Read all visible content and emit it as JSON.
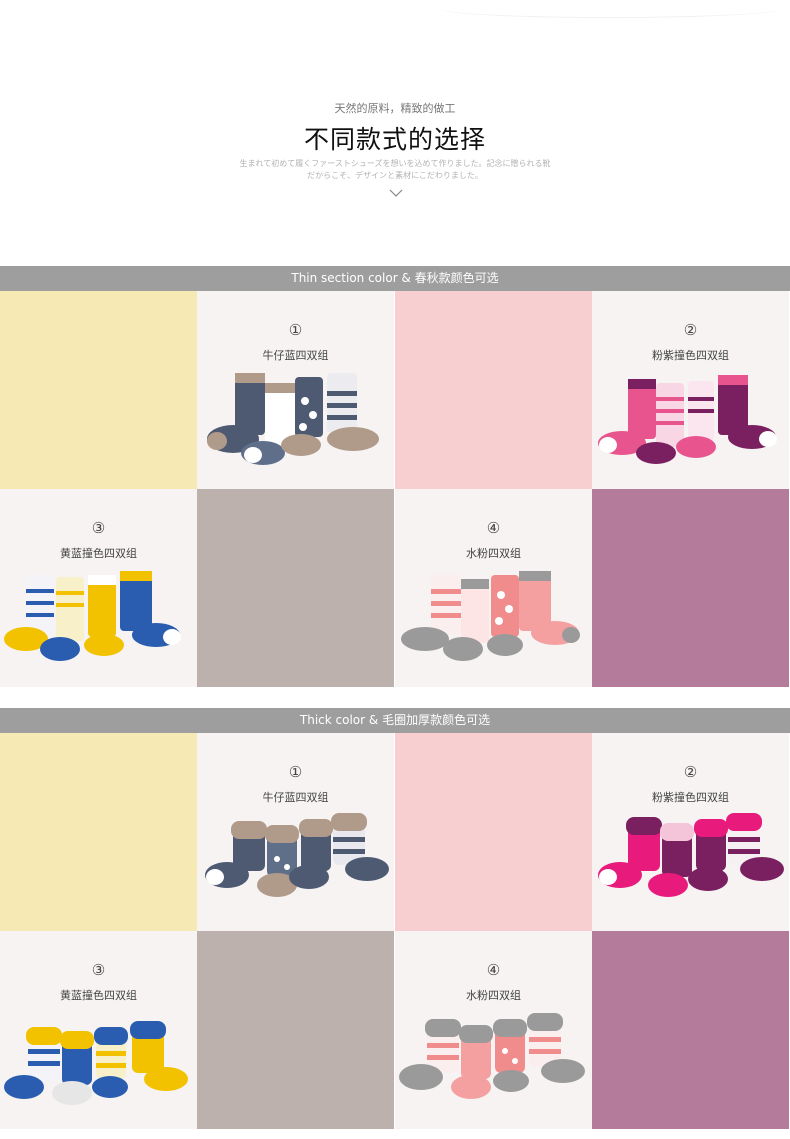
{
  "hero": {
    "subtitle": "天然的原料，精致的做工",
    "title": "不同款式的选择",
    "jp_line1": "生まれて初めて履くファーストシューズを想いを込めて作りました。記念に贈られる靴",
    "jp_line2": "だからこそ、デザインと素材にこだわりました。",
    "icon": "chevron-down-icon"
  },
  "sections": [
    {
      "header": "Thin section color & 春秋款颜色可选",
      "products": [
        {
          "num": "①",
          "label": "牛仔蓝四双组"
        },
        {
          "num": "②",
          "label": "粉紫撞色四双组"
        },
        {
          "num": "③",
          "label": "黄蓝撞色四双组"
        },
        {
          "num": "④",
          "label": "水粉四双组"
        }
      ]
    },
    {
      "header": "Thick color & 毛圈加厚款颜色可选",
      "products": [
        {
          "num": "①",
          "label": "牛仔蓝四双组"
        },
        {
          "num": "②",
          "label": "粉紫撞色四双组"
        },
        {
          "num": "③",
          "label": "黄蓝撞色四双组"
        },
        {
          "num": "④",
          "label": "水粉四双组"
        }
      ]
    }
  ],
  "colors": {
    "yellow_block": "#f7e9b4",
    "pink_block": "#f8cfd1",
    "gray_block": "#bdb1ae",
    "purple_block": "#b47c9a",
    "bar": "#9e9e9e"
  }
}
